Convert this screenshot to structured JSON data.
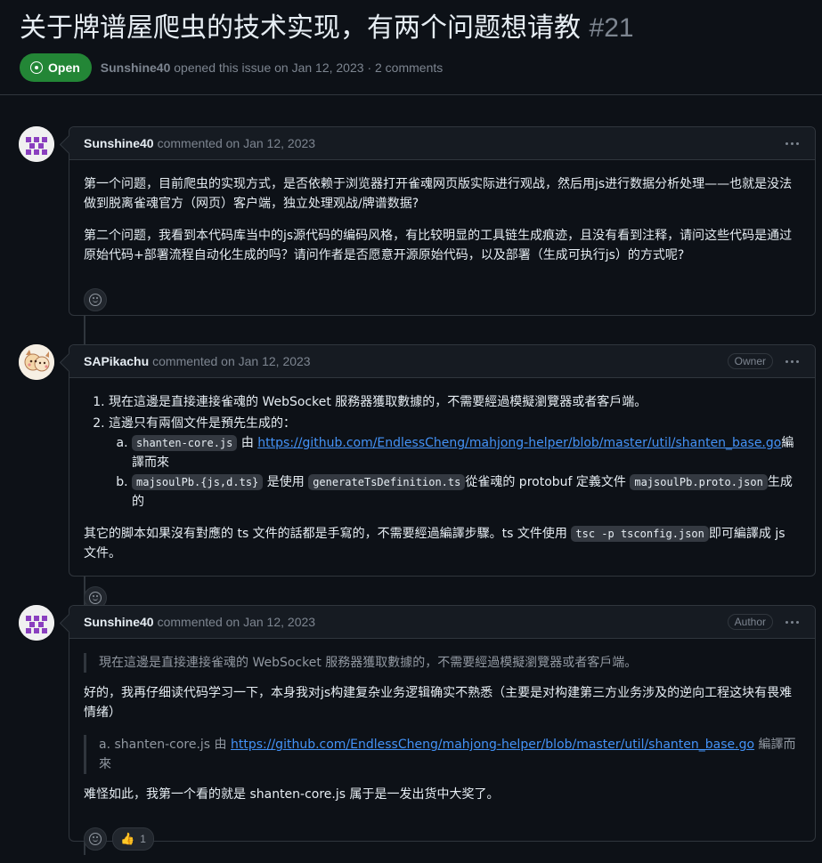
{
  "issue": {
    "title": "关于牌谱屋爬虫的技术实现，有两个问题想请教",
    "number": "#21",
    "state": "Open",
    "author": "Sunshine40",
    "opened_text": "opened this issue on Jan 12, 2023",
    "separator": "·",
    "comments_count": "2 comments"
  },
  "comments": [
    {
      "author": "Sunshine40",
      "action": "commented on Jan 12, 2023",
      "badge": "",
      "paragraphs": [
        "第一个问题，目前爬虫的实现方式，是否依赖于浏览器打开雀魂网页版实际进行观战，然后用js进行数据分析处理——也就是没法做到脱离雀魂官方（网页）客户端，独立处理观战/牌谱数据?",
        "第二个问题，我看到本代码库当中的js源代码的编码风格，有比较明显的工具链生成痕迹，且没有看到注释，请问这些代码是通过原始代码+部署流程自动化生成的吗？请问作者是否愿意开源原始代码，以及部署（生成可执行js）的方式呢?"
      ]
    },
    {
      "author": "SAPikachu",
      "action": "commented on Jan 12, 2023",
      "badge": "Owner",
      "item1": "現在這邊是直接連接雀魂的 WebSocket 服務器獲取數據的，不需要經過模擬瀏覽器或者客戶端。",
      "item2": "這邊只有兩個文件是預先生成的：",
      "sub_a_code": "shanten-core.js",
      "sub_a_mid": "由",
      "sub_a_link": "https://github.com/EndlessCheng/mahjong-helper/blob/master/util/shanten_base.go",
      "sub_a_end": "編譯而來",
      "sub_b_code1": "majsoulPb.{js,d.ts}",
      "sub_b_mid1": "是使用",
      "sub_b_code2": "generateTsDefinition.ts",
      "sub_b_mid2": "從雀魂的 protobuf 定義文件",
      "sub_b_code3": "majsoulPb.proto.json",
      "sub_b_end": "生成的",
      "para_start": "其它的脚本如果沒有對應的 ts 文件的話都是手寫的，不需要經過編譯步驟。ts 文件使用",
      "para_code": "tsc -p tsconfig.json",
      "para_end": "即可編譯成 js 文件。"
    },
    {
      "author": "Sunshine40",
      "action": "commented on Jan 12, 2023",
      "badge": "Author",
      "quote1": "現在這邊是直接連接雀魂的 WebSocket 服務器獲取數據的，不需要經過模擬瀏覽器或者客戶端。",
      "para1": "好的，我再仔细读代码学习一下，本身我对js构建复杂业务逻辑确实不熟悉（主要是对构建第三方业务涉及的逆向工程这块有畏难情绪）",
      "quote2_start": "a. shanten-core.js 由",
      "quote2_link": "https://github.com/EndlessCheng/mahjong-helper/blob/master/util/shanten_base.go",
      "quote2_end": "編譯而來",
      "para2": "难怪如此，我第一个看的就是 shanten-core.js 属于是一发出货中大奖了。",
      "reaction_emoji": "👍",
      "reaction_count": "1"
    }
  ],
  "colors": {
    "background": "#0d1117",
    "header": "#161b22",
    "border": "#30363d",
    "open_green": "#238636",
    "link": "#4493f8",
    "muted": "#7d8590"
  }
}
